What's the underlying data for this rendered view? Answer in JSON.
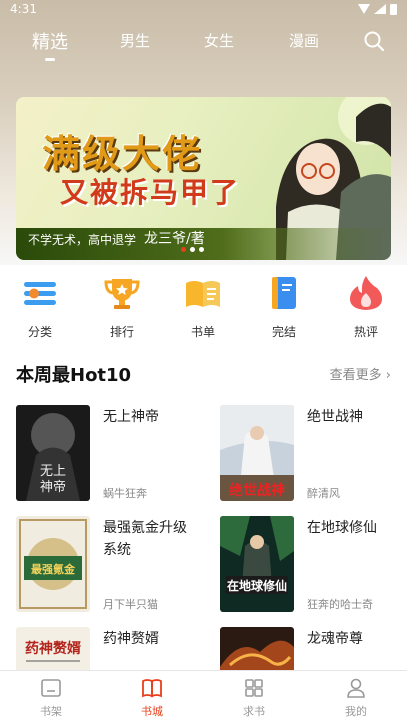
{
  "status": {
    "time": "4:31"
  },
  "nav": {
    "tabs": [
      {
        "label": "精选",
        "active": true
      },
      {
        "label": "男生"
      },
      {
        "label": "女生"
      },
      {
        "label": "漫画"
      }
    ],
    "search_icon": "search-icon"
  },
  "banner": {
    "title_line1": "满级大佬",
    "title_line2": "又被拆马甲了",
    "subtitle": "不学无术，高中退学",
    "author": "龙三爷/著",
    "dots_total": 3,
    "dots_active": 0
  },
  "quick_links": [
    {
      "label": "分类",
      "icon": "category-icon",
      "color": "#3b9cf0"
    },
    {
      "label": "排行",
      "icon": "trophy-icon",
      "color": "#f6a623"
    },
    {
      "label": "书单",
      "icon": "book-list-icon",
      "color": "#f8b62c"
    },
    {
      "label": "完结",
      "icon": "finished-book-icon",
      "color": "#3a8ef0"
    },
    {
      "label": "热评",
      "icon": "hot-comment-icon",
      "color": "#f25a5a"
    }
  ],
  "section": {
    "title": "本周最Hot10",
    "more": "查看更多"
  },
  "books": [
    {
      "title": "无上神帝",
      "author": "蜗牛狂奔"
    },
    {
      "title": "绝世战神",
      "author": "醉清风"
    },
    {
      "title": "最强氪金升级系统",
      "author": "月下半只猫"
    },
    {
      "title": "在地球修仙",
      "author": "狂奔的哈士奇"
    },
    {
      "title": "药神赘婿",
      "author": ""
    },
    {
      "title": "龙魂帝尊",
      "author": ""
    }
  ],
  "tabbar": [
    {
      "label": "书架",
      "icon": "bookshelf-icon"
    },
    {
      "label": "书城",
      "icon": "bookstore-icon",
      "active": true
    },
    {
      "label": "求书",
      "icon": "request-book-icon"
    },
    {
      "label": "我的",
      "icon": "profile-icon"
    }
  ],
  "colors": {
    "accent": "#e8401c",
    "muted": "#888888"
  }
}
